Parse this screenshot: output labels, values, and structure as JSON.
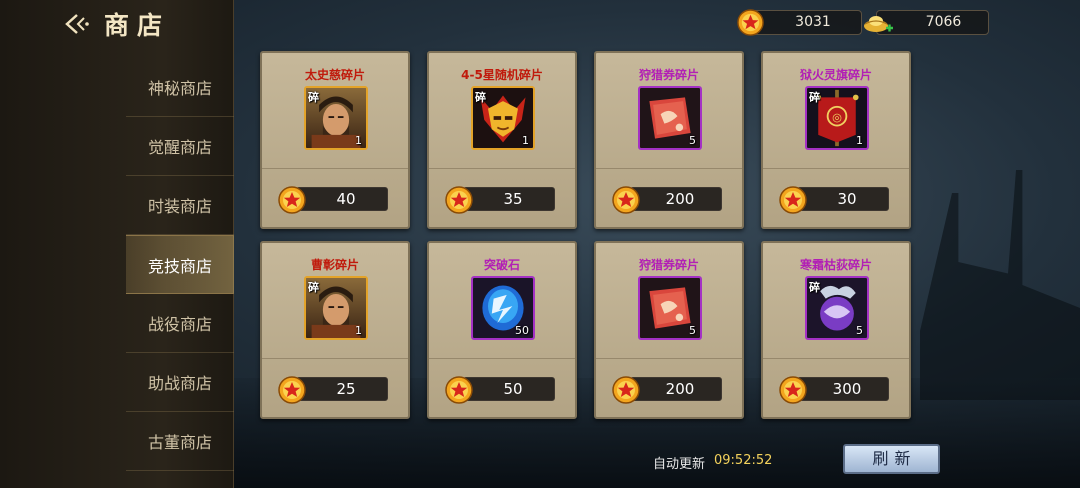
{
  "header": {
    "title": "商店"
  },
  "sidebar": {
    "items": [
      {
        "label": "神秘商店"
      },
      {
        "label": "觉醒商店"
      },
      {
        "label": "时装商店"
      },
      {
        "label": "竞技商店",
        "active": true
      },
      {
        "label": "战役商店"
      },
      {
        "label": "助战商店"
      },
      {
        "label": "古董商店"
      }
    ]
  },
  "currency": {
    "coins": "3031",
    "ingots": "7066"
  },
  "shop": {
    "items": [
      {
        "name": "太史慈碎片",
        "qty": "1",
        "price": "40",
        "icon": "hero-portrait-icon",
        "fragment_tag": "碎"
      },
      {
        "name": "4-5星随机碎片",
        "qty": "1",
        "price": "35",
        "icon": "golden-mask-icon",
        "fragment_tag": "碎"
      },
      {
        "name": "狩猎券碎片",
        "qty": "5",
        "price": "200",
        "icon": "red-scroll-icon"
      },
      {
        "name": "狱火灵旗碎片",
        "qty": "1",
        "price": "30",
        "icon": "red-banner-icon",
        "fragment_tag": "碎"
      },
      {
        "name": "曹彰碎片",
        "qty": "1",
        "price": "25",
        "icon": "hero-portrait-icon",
        "fragment_tag": "碎"
      },
      {
        "name": "突破石",
        "qty": "50",
        "price": "50",
        "icon": "blue-gem-icon"
      },
      {
        "name": "狩猎券碎片",
        "qty": "5",
        "price": "200",
        "icon": "red-scroll-icon"
      },
      {
        "name": "寒霜枯荻碎片",
        "qty": "5",
        "price": "300",
        "icon": "frost-orb-icon",
        "fragment_tag": "碎"
      }
    ]
  },
  "footer": {
    "auto_refresh_label": "自动更新",
    "refresh_time": "09:52:52",
    "refresh_button": "刷新"
  }
}
